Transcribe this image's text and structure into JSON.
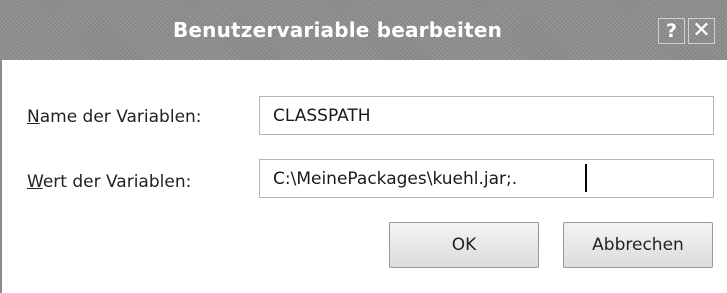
{
  "window": {
    "title": "Benutzervariable bearbeiten",
    "help_glyph": "?",
    "close_glyph": "✕"
  },
  "form": {
    "name_label_mnemonic": "N",
    "name_label_rest": "ame der Variablen:",
    "name_value": "CLASSPATH",
    "value_label_mnemonic": "W",
    "value_label_rest": "ert der Variablen:",
    "value_value": "C:\\MeinePackages\\kuehl.jar;."
  },
  "buttons": {
    "ok_label": "OK",
    "cancel_label": "Abbrechen"
  },
  "colors": {
    "titlebar": "#8c8c8c",
    "title_text": "#ffffff",
    "background": "#ffffff"
  }
}
